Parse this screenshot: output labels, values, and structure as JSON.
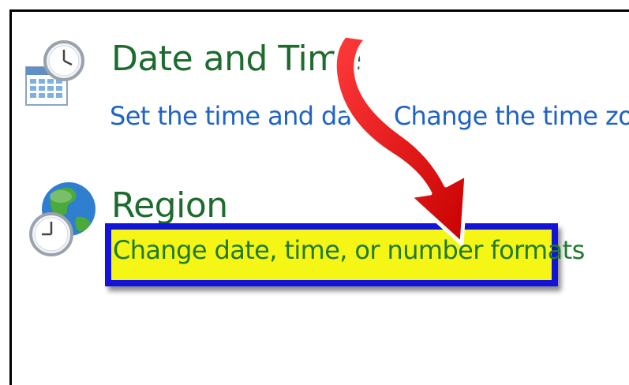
{
  "date_time": {
    "title": "Date and Time",
    "link_set_time": "Set the time and date",
    "link_change_zone": "Change the time zone",
    "icon": "calendar-clock-icon"
  },
  "region": {
    "title": "Region",
    "link_formats": "Change date, time, or number formats",
    "icon": "globe-clock-icon"
  },
  "annotation": {
    "arrow_icon": "red-arrow-icon",
    "highlight_color": "#f5f516",
    "border_color": "#1414d8",
    "arrow_color": "#e01010"
  }
}
